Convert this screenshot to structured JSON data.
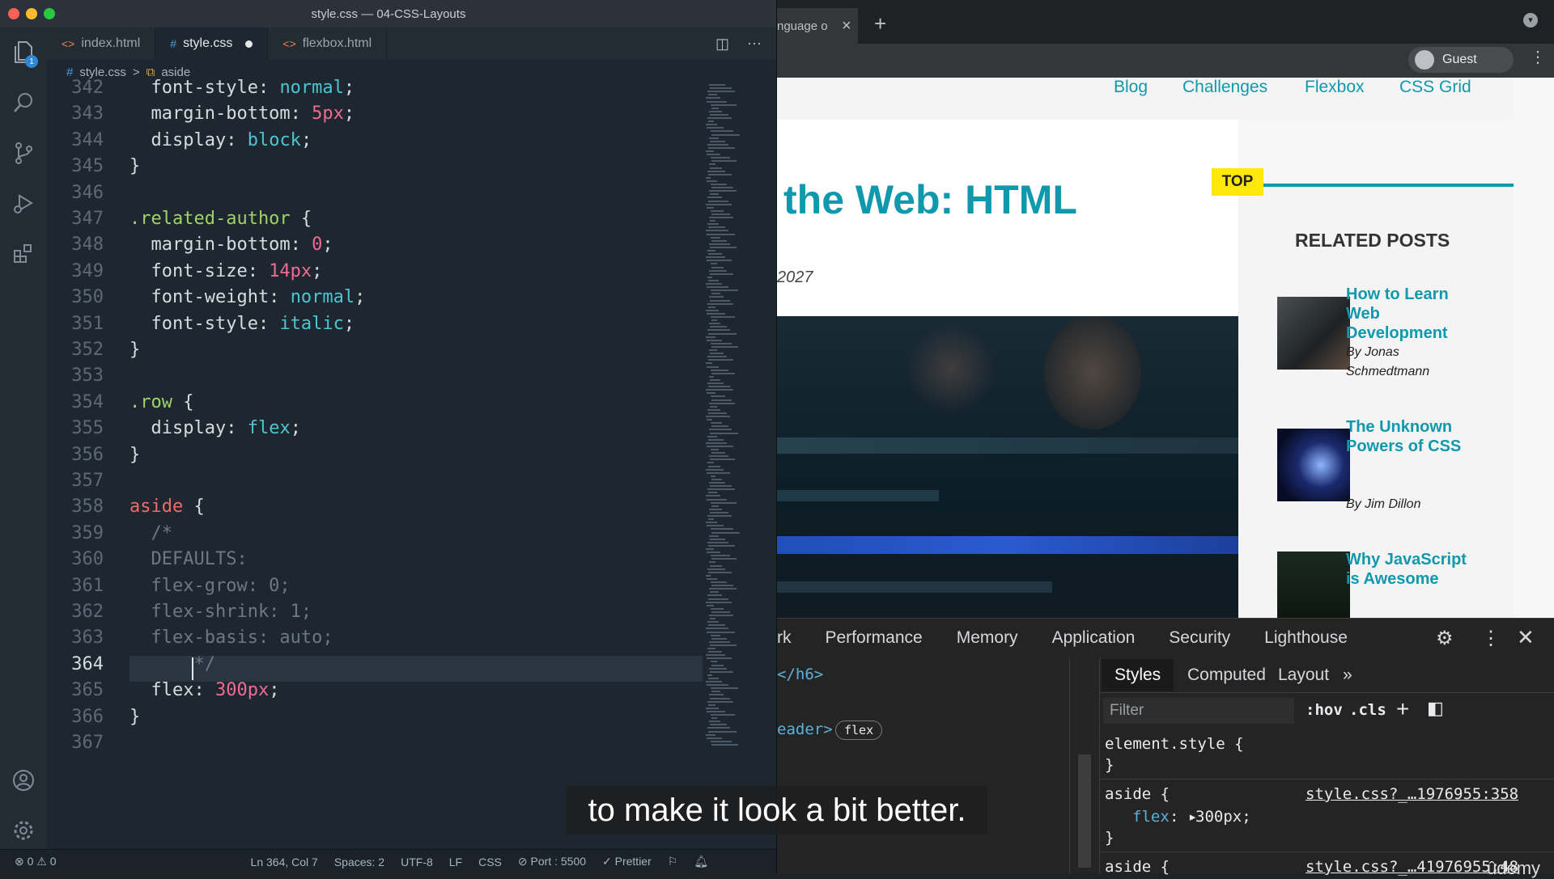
{
  "vscode": {
    "title": "style.css — 04-CSS-Layouts",
    "tabs": [
      {
        "icon": "<>",
        "label": "index.html"
      },
      {
        "icon": "#",
        "label": "style.css"
      },
      {
        "icon": "<>",
        "label": "flexbox.html"
      }
    ],
    "breadcrumb": {
      "file": "style.css",
      "sep": ">",
      "symbol": "aside"
    },
    "activity_badge": "1",
    "lines": [
      {
        "n": "342",
        "code": [
          [
            "prop",
            "  font-style: "
          ],
          [
            "kw",
            "normal"
          ],
          [
            "prop",
            ";"
          ]
        ]
      },
      {
        "n": "343",
        "code": [
          [
            "prop",
            "  margin-bottom: "
          ],
          [
            "num",
            "5px"
          ],
          [
            "prop",
            ";"
          ]
        ]
      },
      {
        "n": "344",
        "code": [
          [
            "prop",
            "  display: "
          ],
          [
            "kw",
            "block"
          ],
          [
            "prop",
            ";"
          ]
        ]
      },
      {
        "n": "345",
        "code": [
          [
            "prop",
            "}"
          ]
        ]
      },
      {
        "n": "346",
        "code": []
      },
      {
        "n": "347",
        "code": [
          [
            "sel",
            ".related-author"
          ],
          [
            "prop",
            " {"
          ]
        ]
      },
      {
        "n": "348",
        "code": [
          [
            "prop",
            "  margin-bottom: "
          ],
          [
            "num",
            "0"
          ],
          [
            "prop",
            ";"
          ]
        ]
      },
      {
        "n": "349",
        "code": [
          [
            "prop",
            "  font-size: "
          ],
          [
            "num",
            "14px"
          ],
          [
            "prop",
            ";"
          ]
        ]
      },
      {
        "n": "350",
        "code": [
          [
            "prop",
            "  font-weight: "
          ],
          [
            "kw",
            "normal"
          ],
          [
            "prop",
            ";"
          ]
        ]
      },
      {
        "n": "351",
        "code": [
          [
            "prop",
            "  font-style: "
          ],
          [
            "kw",
            "italic"
          ],
          [
            "prop",
            ";"
          ]
        ]
      },
      {
        "n": "352",
        "code": [
          [
            "prop",
            "}"
          ]
        ]
      },
      {
        "n": "353",
        "code": []
      },
      {
        "n": "354",
        "code": [
          [
            "sel",
            ".row"
          ],
          [
            "prop",
            " {"
          ]
        ]
      },
      {
        "n": "355",
        "code": [
          [
            "prop",
            "  display: "
          ],
          [
            "kw",
            "flex"
          ],
          [
            "prop",
            ";"
          ]
        ]
      },
      {
        "n": "356",
        "code": [
          [
            "prop",
            "}"
          ]
        ]
      },
      {
        "n": "357",
        "code": []
      },
      {
        "n": "358",
        "code": [
          [
            "tag",
            "aside"
          ],
          [
            "prop",
            " {"
          ]
        ]
      },
      {
        "n": "359",
        "code": [
          [
            "com",
            "  /*"
          ]
        ]
      },
      {
        "n": "360",
        "code": [
          [
            "com",
            "  DEFAULTS:"
          ]
        ]
      },
      {
        "n": "361",
        "code": [
          [
            "com",
            "  flex-grow: 0;"
          ]
        ]
      },
      {
        "n": "362",
        "code": [
          [
            "com",
            "  flex-shrink: 1;"
          ]
        ]
      },
      {
        "n": "363",
        "code": [
          [
            "com",
            "  flex-basis: auto;"
          ]
        ]
      },
      {
        "n": "364",
        "code": [
          [
            "com",
            "      */"
          ]
        ]
      },
      {
        "n": "365",
        "code": [
          [
            "prop",
            "  flex: "
          ],
          [
            "num",
            "300px"
          ],
          [
            "prop",
            ";"
          ]
        ]
      },
      {
        "n": "366",
        "code": [
          [
            "prop",
            "}"
          ]
        ]
      },
      {
        "n": "367",
        "code": []
      }
    ],
    "status": {
      "errors": "⊗ 0 ⚠ 0",
      "position": "Ln 364, Col 7",
      "spaces": "Spaces: 2",
      "encoding": "UTF-8",
      "eol": "LF",
      "lang": "CSS",
      "port": "⊘ Port : 5500",
      "prettier": "✓ Prettier"
    }
  },
  "browser": {
    "tab_label": "nguage o",
    "profile": "Guest",
    "nav": [
      "Blog",
      "Challenges",
      "Flexbox",
      "CSS Grid"
    ],
    "post_title": "the Web: HTML",
    "date": "2027",
    "top_badge": "TOP",
    "related_heading": "RELATED POSTS",
    "related": [
      {
        "title": "How to Learn Web Development",
        "author": "By Jonas Schmedtmann"
      },
      {
        "title": "The Unknown Powers of CSS",
        "author": "By Jim Dillon"
      },
      {
        "title": "Why JavaScript is Awesome",
        "author": ""
      }
    ]
  },
  "devtools": {
    "tabs": [
      "rk",
      "Performance",
      "Memory",
      "Application",
      "Security",
      "Lighthouse"
    ],
    "elements": [
      "</h6>",
      "eader>"
    ],
    "flex_badge": "flex",
    "subtabs": [
      "Styles",
      "Computed",
      "Layout",
      "»"
    ],
    "filter_placeholder": "Filter",
    "hov": ":hov",
    "cls": ".cls",
    "rules": [
      {
        "selector": "element.style {",
        "prop": "",
        "value": "",
        "close": "}",
        "source": ""
      },
      {
        "selector": "aside {",
        "prop": "flex",
        "value": "300px;",
        "close": "}",
        "source": "style.css?_…1976955:358"
      },
      {
        "selector": "aside {",
        "prop": "",
        "value": "",
        "close": "",
        "source": "style.css?_…41976955:48"
      }
    ]
  },
  "subtitle": "to make it look a bit better.",
  "watermark": "ûdemy"
}
